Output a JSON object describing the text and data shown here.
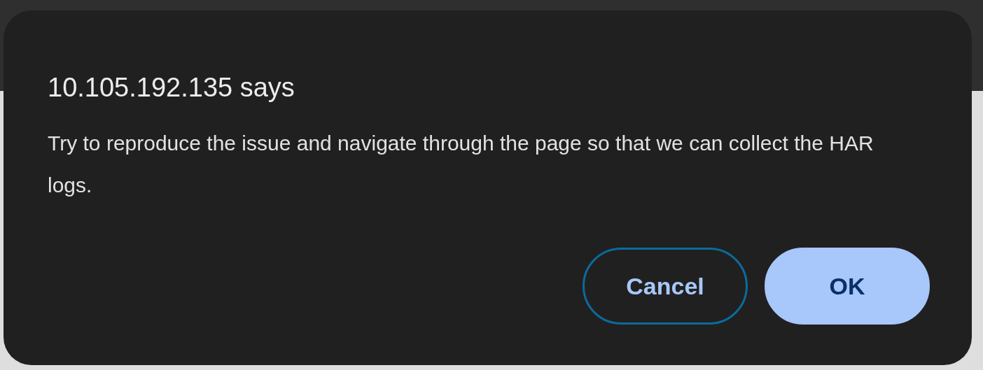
{
  "dialog": {
    "title": "10.105.192.135 says",
    "message": "Try to reproduce the issue and navigate through the page so that we can collect the HAR logs.",
    "buttons": [
      {
        "label": "Cancel",
        "kind": "secondary",
        "focused": true
      },
      {
        "label": "OK",
        "kind": "primary",
        "focused": false
      }
    ]
  }
}
